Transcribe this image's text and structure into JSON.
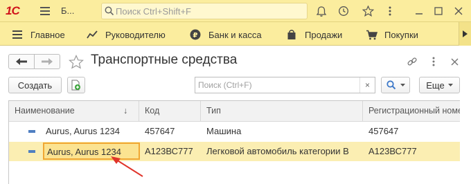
{
  "app": {
    "logo": "1С",
    "title": "Б...",
    "search_placeholder": "Поиск Ctrl+Shift+F"
  },
  "sections": [
    {
      "label": "Главное",
      "icon": "menu-icon"
    },
    {
      "label": "Руководителю",
      "icon": "chart-icon"
    },
    {
      "label": "Банк и касса",
      "icon": "ruble-icon"
    },
    {
      "label": "Продажи",
      "icon": "bag-icon"
    },
    {
      "label": "Покупки",
      "icon": "cart-icon"
    }
  ],
  "form": {
    "title": "Транспортные средства",
    "create_label": "Создать",
    "search_placeholder": "Поиск (Ctrl+F)",
    "clear_glyph": "×",
    "more_label": "Еще"
  },
  "table": {
    "columns": [
      "Наименование",
      "Код",
      "Тип",
      "Регистрационный номер"
    ],
    "sort_indicator": "↓",
    "rows": [
      {
        "name": "Aurus, Aurus 1234",
        "code": "457647",
        "type": "Машина",
        "reg": "457647",
        "selected": false
      },
      {
        "name": "Aurus, Aurus 1234",
        "code": "А123ВС777",
        "type": "Легковой автомобиль категории В",
        "reg": "А123ВС777",
        "selected": true
      }
    ]
  },
  "colors": {
    "brand_red": "#d0131b",
    "panel_yellow": "#fbed9e",
    "selection": "#fbeeb2",
    "current_cell_border": "#f0a733",
    "annotation_arrow": "#e0342a"
  }
}
